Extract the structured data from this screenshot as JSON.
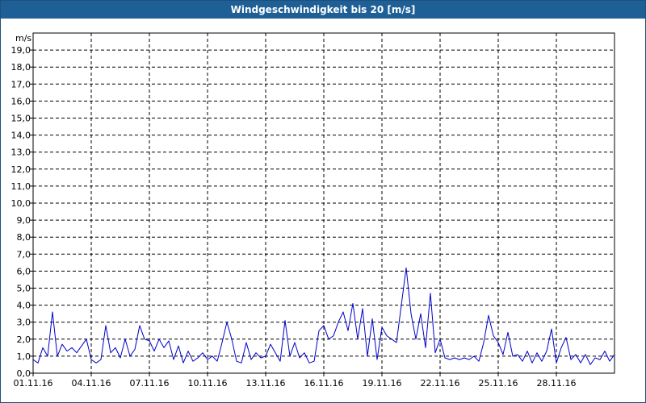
{
  "window": {
    "title": "Windgeschwindigkeit bis 20 [m/s]"
  },
  "chart_data": {
    "type": "line",
    "title": "Windgeschwindigkeit bis 20 [m/s]",
    "ylabel": "m/s",
    "xlabel": "",
    "ylim": [
      0,
      20
    ],
    "yticks": [
      "0,0",
      "1,0",
      "2,0",
      "3,0",
      "4,0",
      "5,0",
      "6,0",
      "7,0",
      "8,0",
      "9,0",
      "10,0",
      "11,0",
      "12,0",
      "13,0",
      "14,0",
      "15,0",
      "16,0",
      "17,0",
      "18,0",
      "19,0"
    ],
    "xlim": [
      "2016-11-01",
      "2016-12-01"
    ],
    "xticks": [
      "01.11.16",
      "04.11.16",
      "07.11.16",
      "10.11.16",
      "13.11.16",
      "16.11.16",
      "19.11.16",
      "22.11.16",
      "25.11.16",
      "28.11.16"
    ],
    "grid": true,
    "line_color": "#0000c8",
    "series": [
      {
        "x": [
          "2016-11-01",
          "2016-11-01 06:00",
          "2016-11-01 12:00",
          "2016-11-01 18:00",
          "2016-11-02",
          "2016-11-02 06:00",
          "2016-11-02 12:00",
          "2016-11-02 18:00",
          "2016-11-03",
          "2016-11-03 06:00",
          "2016-11-03 12:00",
          "2016-11-03 18:00",
          "2016-11-04",
          "2016-11-04 06:00",
          "2016-11-04 12:00",
          "2016-11-04 18:00",
          "2016-11-05",
          "2016-11-05 06:00",
          "2016-11-05 12:00",
          "2016-11-05 18:00",
          "2016-11-06",
          "2016-11-06 06:00",
          "2016-11-06 12:00",
          "2016-11-06 18:00",
          "2016-11-07",
          "2016-11-07 06:00",
          "2016-11-07 12:00",
          "2016-11-07 18:00",
          "2016-11-08",
          "2016-11-08 06:00",
          "2016-11-08 12:00",
          "2016-11-08 18:00",
          "2016-11-09",
          "2016-11-09 06:00",
          "2016-11-09 12:00",
          "2016-11-09 18:00",
          "2016-11-10",
          "2016-11-10 06:00",
          "2016-11-10 12:00",
          "2016-11-10 18:00",
          "2016-11-11",
          "2016-11-11 06:00",
          "2016-11-11 12:00",
          "2016-11-11 18:00",
          "2016-11-12",
          "2016-11-12 06:00",
          "2016-11-12 12:00",
          "2016-11-12 18:00",
          "2016-11-13",
          "2016-11-13 06:00",
          "2016-11-13 12:00",
          "2016-11-13 18:00",
          "2016-11-14",
          "2016-11-14 06:00",
          "2016-11-14 12:00",
          "2016-11-14 18:00",
          "2016-11-15",
          "2016-11-15 06:00",
          "2016-11-15 12:00",
          "2016-11-15 18:00",
          "2016-11-16",
          "2016-11-16 06:00",
          "2016-11-16 12:00",
          "2016-11-16 18:00",
          "2016-11-17",
          "2016-11-17 06:00",
          "2016-11-17 12:00",
          "2016-11-17 18:00",
          "2016-11-18",
          "2016-11-18 06:00",
          "2016-11-18 12:00",
          "2016-11-18 18:00",
          "2016-11-19",
          "2016-11-19 06:00",
          "2016-11-19 12:00",
          "2016-11-19 18:00",
          "2016-11-20",
          "2016-11-20 06:00",
          "2016-11-20 12:00",
          "2016-11-20 18:00",
          "2016-11-21",
          "2016-11-21 06:00",
          "2016-11-21 12:00",
          "2016-11-21 18:00",
          "2016-11-22",
          "2016-11-22 06:00",
          "2016-11-22 12:00",
          "2016-11-22 18:00",
          "2016-11-23",
          "2016-11-23 06:00",
          "2016-11-23 12:00",
          "2016-11-23 18:00",
          "2016-11-24",
          "2016-11-24 06:00",
          "2016-11-24 12:00",
          "2016-11-24 18:00",
          "2016-11-25",
          "2016-11-25 06:00",
          "2016-11-25 12:00",
          "2016-11-25 18:00",
          "2016-11-26",
          "2016-11-26 06:00",
          "2016-11-26 12:00",
          "2016-11-26 18:00",
          "2016-11-27",
          "2016-11-27 06:00",
          "2016-11-27 12:00",
          "2016-11-27 18:00",
          "2016-11-28",
          "2016-11-28 06:00",
          "2016-11-28 12:00",
          "2016-11-28 18:00",
          "2016-11-29",
          "2016-11-29 06:00",
          "2016-11-29 12:00",
          "2016-11-29 18:00",
          "2016-11-30",
          "2016-11-30 06:00",
          "2016-11-30 12:00",
          "2016-11-30 18:00",
          "2016-12-01"
        ],
        "values": [
          0.8,
          0.6,
          1.5,
          1.0,
          3.6,
          1.0,
          1.7,
          1.3,
          1.5,
          1.2,
          1.6,
          2.0,
          0.8,
          0.6,
          0.8,
          2.8,
          1.2,
          1.5,
          0.9,
          2.0,
          1.0,
          1.4,
          2.8,
          2.0,
          1.9,
          1.3,
          2.0,
          1.5,
          1.9,
          0.8,
          1.6,
          0.6,
          1.3,
          0.7,
          0.9,
          1.2,
          0.8,
          1.0,
          0.7,
          1.8,
          3.0,
          2.0,
          0.7,
          0.6,
          1.8,
          0.8,
          1.2,
          0.9,
          1.0,
          1.7,
          1.2,
          0.7,
          3.1,
          1.0,
          1.8,
          0.9,
          1.2,
          0.6,
          0.7,
          2.5,
          2.8,
          2.0,
          2.2,
          3.0,
          3.6,
          2.5,
          4.1,
          2.0,
          3.8,
          1.0,
          3.2,
          0.8,
          2.7,
          2.2,
          2.0,
          1.8,
          4.0,
          6.2,
          3.5,
          2.0,
          3.5,
          1.5,
          4.7,
          1.2,
          2.0,
          0.9,
          0.8,
          0.9,
          0.8,
          0.9,
          0.8,
          1.0,
          0.7,
          1.8,
          3.4,
          2.2,
          1.8,
          1.1,
          2.4,
          1.0,
          1.1,
          0.7,
          1.3,
          0.6,
          1.2,
          0.7,
          1.3,
          2.6,
          0.6,
          1.5,
          2.1,
          0.8,
          1.1,
          0.6,
          1.1,
          0.5,
          0.9,
          0.8,
          1.3,
          0.7,
          1.1
        ]
      }
    ]
  }
}
